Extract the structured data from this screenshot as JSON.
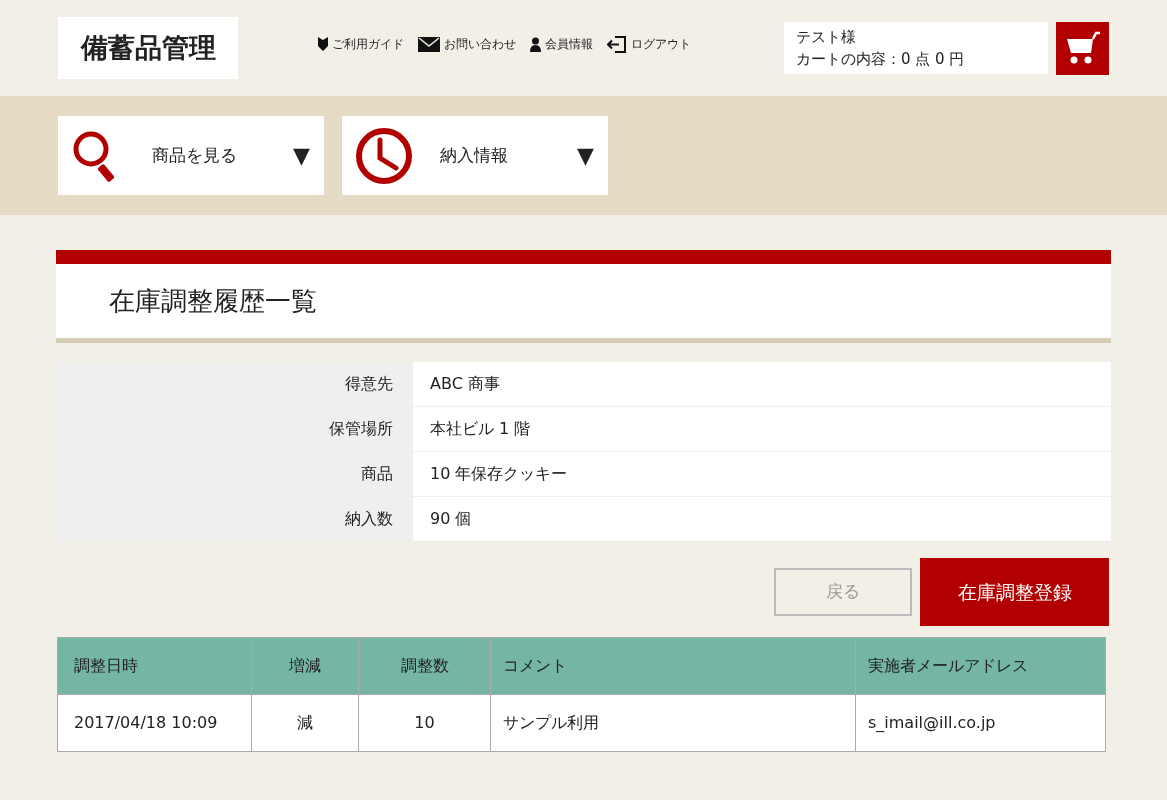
{
  "header": {
    "logo": "備蓄品管理",
    "links": [
      {
        "kind": "guide",
        "label": "ご利用ガイド"
      },
      {
        "kind": "mail",
        "label": "お問い合わせ"
      },
      {
        "kind": "member",
        "label": "会員情報"
      },
      {
        "kind": "logout",
        "label": "ログアウト"
      }
    ],
    "user": "テスト様",
    "cart_summary": "カートの内容：0 点 0 円"
  },
  "menu": [
    {
      "kind": "search",
      "label": "商品を見る",
      "caret": "▼"
    },
    {
      "kind": "clock",
      "label": "納入情報",
      "caret": "▼"
    }
  ],
  "page_title": "在庫調整履歴一覧",
  "details": [
    {
      "label": "得意先",
      "value": "ABC 商事"
    },
    {
      "label": "保管場所",
      "value": "本社ビル 1 階"
    },
    {
      "label": "商品",
      "value": "10 年保存クッキー"
    },
    {
      "label": "納入数",
      "value": "90 個"
    }
  ],
  "buttons": {
    "back": {
      "label": "戻る",
      "disabled": true
    },
    "register": {
      "label": "在庫調整登録"
    }
  },
  "table": {
    "columns": [
      "調整日時",
      "増減",
      "調整数",
      "コメント",
      "実施者メールアドレス"
    ],
    "rows": [
      [
        "2017/04/18 10:09",
        "減",
        "10",
        "サンプル利用",
        "s_imail@ill.co.jp"
      ]
    ]
  }
}
